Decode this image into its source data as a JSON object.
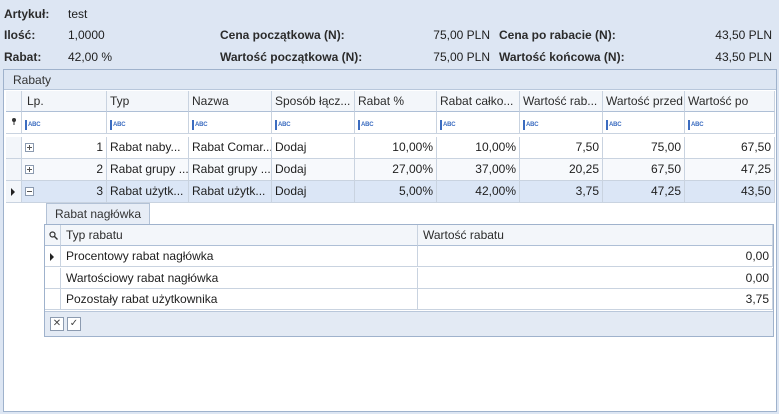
{
  "header": {
    "artykul_label": "Artykuł:",
    "artykul_value": "test",
    "ilosc_label": "Ilość:",
    "ilosc_value": "1,0000",
    "rabat_label": "Rabat:",
    "rabat_value": "42,00 %",
    "cena_pocz_label": "Cena początkowa (N):",
    "cena_pocz_value": "75,00 PLN",
    "wart_pocz_label": "Wartość początkowa (N):",
    "wart_pocz_value": "75,00 PLN",
    "cena_rab_label": "Cena po rabacie (N):",
    "cena_rab_value": "43,50 PLN",
    "wart_konc_label": "Wartość końcowa (N):",
    "wart_konc_value": "43,50 PLN"
  },
  "group": {
    "title": "Rabaty"
  },
  "grid": {
    "columns": [
      "Lp.",
      "Typ",
      "Nazwa",
      "Sposób łącz...",
      "Rabat %",
      "Rabat całko...",
      "Wartość rab...",
      "Wartość przed",
      "Wartość po"
    ],
    "filter_icon": "abc-filter-icon",
    "rows": [
      {
        "lp": "1",
        "typ": "Rabat naby...",
        "nazwa": "Rabat Comar...",
        "sposob": "Dodaj",
        "rabat": "10,00%",
        "rabat_calk": "10,00%",
        "wartosc_rab": "7,50",
        "przed": "75,00",
        "po": "67,50"
      },
      {
        "lp": "2",
        "typ": "Rabat grupy ...",
        "nazwa": "Rabat grupy ...",
        "sposob": "Dodaj",
        "rabat": "27,00%",
        "rabat_calk": "37,00%",
        "wartosc_rab": "20,25",
        "przed": "67,50",
        "po": "47,25"
      },
      {
        "lp": "3",
        "typ": "Rabat użytk...",
        "nazwa": "Rabat użytk...",
        "sposob": "Dodaj",
        "rabat": "5,00%",
        "rabat_calk": "42,00%",
        "wartosc_rab": "3,75",
        "przed": "47,25",
        "po": "43,50"
      }
    ]
  },
  "detail": {
    "tab_label": "Rabat nagłówka",
    "columns": [
      "Typ rabatu",
      "Wartość rabatu"
    ],
    "rows": [
      {
        "typ": "Procentowy rabat nagłówka",
        "wartosc": "0,00"
      },
      {
        "typ": "Wartościowy rabat nagłówka",
        "wartosc": "0,00"
      },
      {
        "typ": "Pozostały rabat użytkownika",
        "wartosc": "3,75"
      }
    ],
    "footer_clear": "✕",
    "footer_check": "✓"
  }
}
